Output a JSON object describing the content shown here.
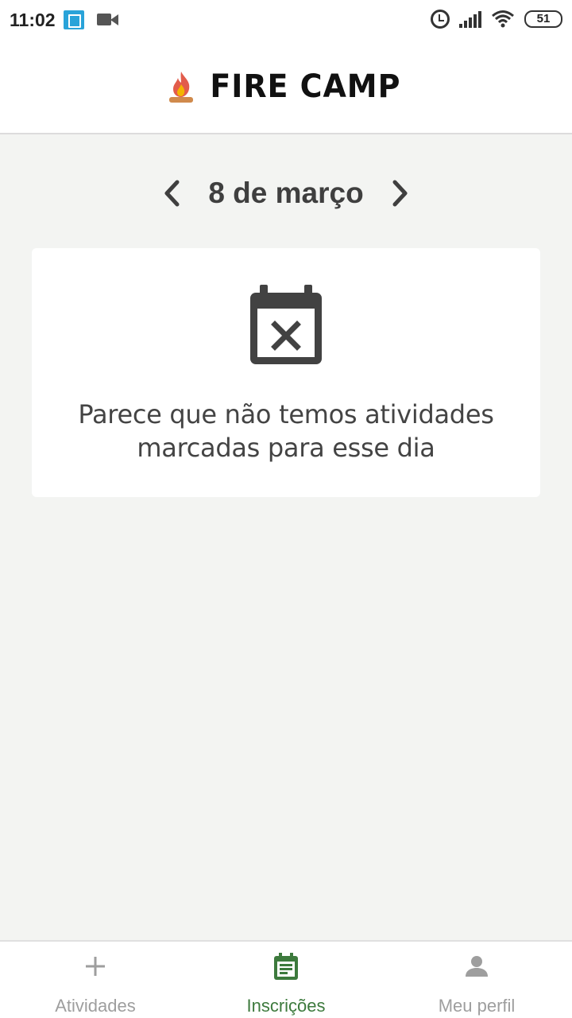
{
  "status_bar": {
    "time": "11:02",
    "battery": "51"
  },
  "header": {
    "app_name": "FIRE CAMP"
  },
  "date_nav": {
    "date": "8 de março"
  },
  "empty_state": {
    "message": "Parece que não temos atividades marcadas para esse dia"
  },
  "bottom_nav": {
    "tabs": [
      {
        "label": "Atividades",
        "icon": "plus-icon",
        "active": false
      },
      {
        "label": "Inscrições",
        "icon": "calendar-list-icon",
        "active": true
      },
      {
        "label": "Meu perfil",
        "icon": "person-icon",
        "active": false
      }
    ]
  },
  "colors": {
    "accent": "#3d7a3d",
    "background": "#f3f4f2",
    "inactive": "#9e9e9e"
  }
}
